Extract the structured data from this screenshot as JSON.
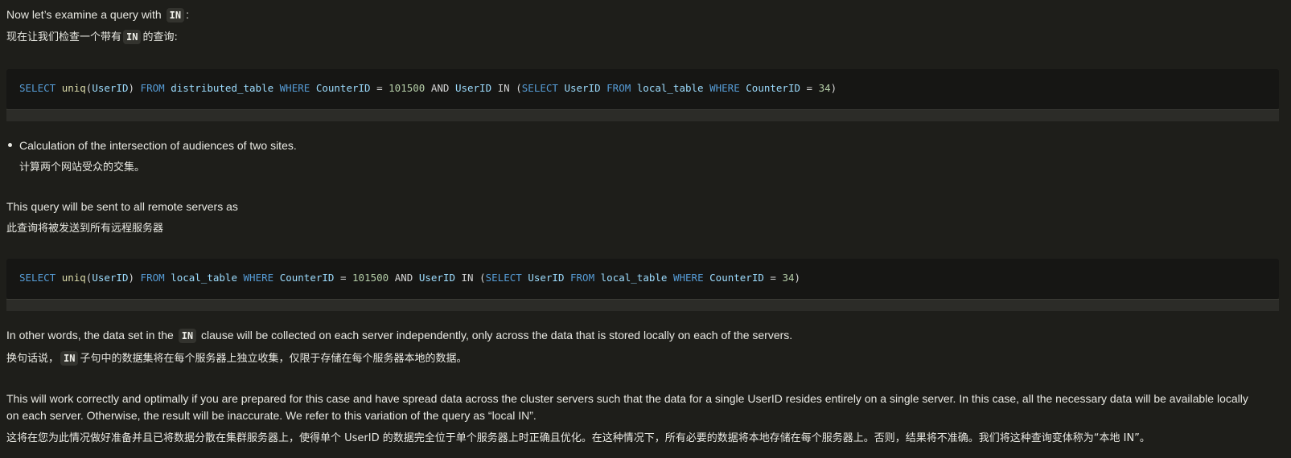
{
  "intro": {
    "en_prefix": "Now let’s examine a query with ",
    "en_code": "IN",
    "en_suffix": ":",
    "zh_prefix": "现在让我们检查一个带有",
    "zh_code": "IN",
    "zh_suffix": "的查询:"
  },
  "code1": {
    "tokens": [
      "SELECT",
      "uniq",
      "(",
      "UserID",
      ")",
      "FROM",
      "distributed_table",
      "WHERE",
      "CounterID",
      "=",
      "101500",
      "AND",
      "UserID",
      "IN",
      "(",
      "SELECT",
      "UserID",
      "FROM",
      "local_table",
      "WHERE",
      "CounterID",
      "=",
      "34",
      ")"
    ]
  },
  "bullet": {
    "en": "Calculation of the intersection of audiences of two sites.",
    "zh": "计算两个网站受众的交集。"
  },
  "sent": {
    "en": "This query will be sent to all remote servers as",
    "zh": "此查询将被发送到所有远程服务器"
  },
  "code2": {
    "tokens": [
      "SELECT",
      "uniq",
      "(",
      "UserID",
      ")",
      "FROM",
      "local_table",
      "WHERE",
      "CounterID",
      "=",
      "101500",
      "AND",
      "UserID",
      "IN",
      "(",
      "SELECT",
      "UserID",
      "FROM",
      "local_table",
      "WHERE",
      "CounterID",
      "=",
      "34",
      ")"
    ]
  },
  "other": {
    "en_prefix": "In other words, the data set in the ",
    "en_code": "IN",
    "en_suffix": " clause will be collected on each server independently, only across the data that is stored locally on each of the servers.",
    "zh_prefix": "换句话说，",
    "zh_code": "IN",
    "zh_suffix": "子句中的数据集将在每个服务器上独立收集，仅限于存储在每个服务器本地的数据。"
  },
  "work": {
    "en": "This will work correctly and optimally if you are prepared for this case and have spread data across the cluster servers such that the data for a single UserID resides entirely on a single server. In this case, all the necessary data will be available locally on each server. Otherwise, the result will be inaccurate. We refer to this variation of the query as “local IN”.",
    "zh": "这将在您为此情况做好准备并且已将数据分散在集群服务器上，使得单个 UserID 的数据完全位于单个服务器上时正确且优化。在这种情况下，所有必要的数据将本地存储在每个服务器上。否则，结果将不准确。我们将这种查询变体称为“本地 IN”。"
  },
  "colors": {
    "keyword": "#569cd6",
    "function": "#dcdcaa",
    "identifier": "#9cdcfe",
    "number": "#b5cea8",
    "background": "#1e1e1a"
  }
}
